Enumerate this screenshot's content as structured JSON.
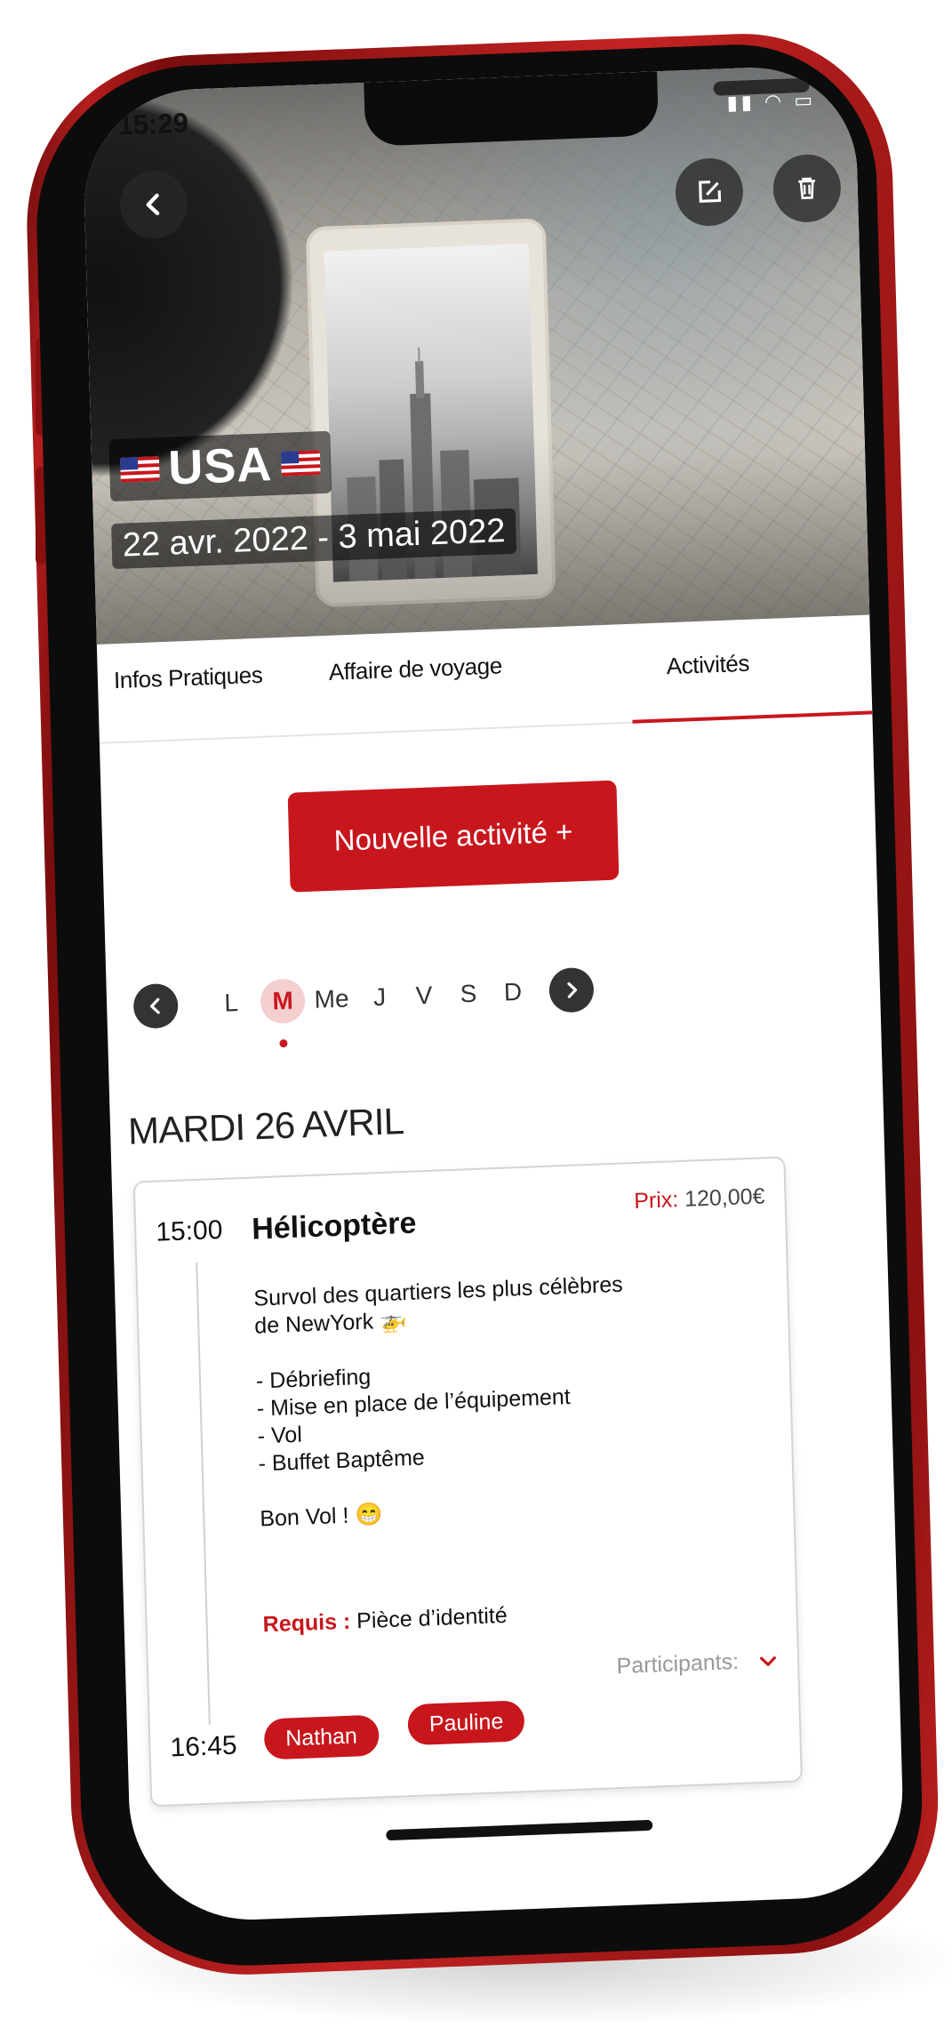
{
  "status_bar": {
    "time": "15:29"
  },
  "trip": {
    "title": "USA",
    "dates": "22 avr. 2022 - 3 mai 2022"
  },
  "tabs": [
    {
      "label": "Infos Pratiques"
    },
    {
      "label": "Affaire de voyage"
    },
    {
      "label": "Activités",
      "active": true
    }
  ],
  "new_activity_label": "Nouvelle activité +",
  "week": {
    "days": [
      "L",
      "M",
      "Me",
      "J",
      "V",
      "S",
      "D"
    ],
    "selected": "M"
  },
  "day_heading": "MARDI 26 AVRIL",
  "activity": {
    "start": "15:00",
    "end": "16:45",
    "title": "Hélicoptère",
    "price_label": "Prix:",
    "price_value": "120,00€",
    "description_lines": [
      "Survol des quartiers les plus célèbres",
      "de NewYork 🚁",
      "",
      "- Débriefing",
      "- Mise en place de l’équipement",
      "- Vol",
      "- Buffet Baptême",
      "",
      "Bon Vol ! 😁"
    ],
    "required_label": "Requis :",
    "required_value": "Pièce d’identité",
    "participants_label": "Participants:",
    "participants": [
      "Nathan",
      "Pauline"
    ]
  },
  "colors": {
    "accent": "#c8161d",
    "accent_light": "#f3cfcf",
    "phone_frame": "#b51d1d"
  },
  "icons": {
    "back": "chevron-left-icon",
    "edit": "edit-icon",
    "delete": "trash-icon",
    "prev_week": "chevron-left-icon",
    "next_week": "chevron-right-icon",
    "participants_toggle": "chevron-down-icon"
  }
}
